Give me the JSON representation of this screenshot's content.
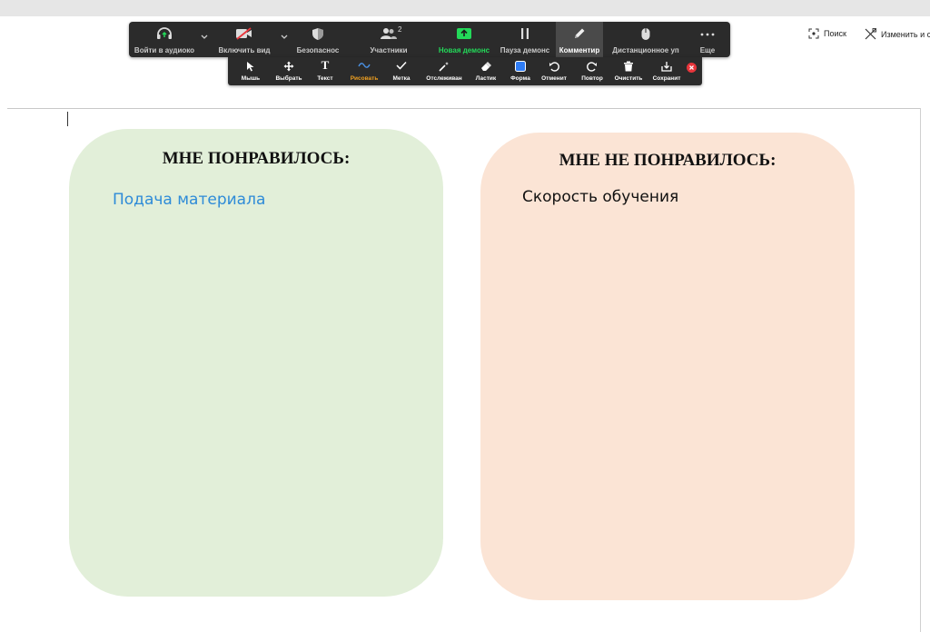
{
  "meeting_toolbar": {
    "audio": "Войти в аудиоко",
    "video": "Включить вид",
    "security": "Безопаснос",
    "participants": "Участники",
    "participants_count": "2",
    "new_share": "Новая демонс",
    "pause_share": "Пауза демонс",
    "annotate": "Комментир",
    "remote_control": "Дистанционное уп",
    "more": "Еще"
  },
  "annotation_toolbar": {
    "mouse": "Мышь",
    "select": "Выбрать",
    "text": "Текст",
    "draw": "Рисовать",
    "stamp": "Метка",
    "spotlight": "Отслеживан",
    "eraser": "Ластик",
    "format": "Форма",
    "undo": "Отменит",
    "redo": "Повтор",
    "clear": "Очистить",
    "save": "Сохранит"
  },
  "right_links": {
    "search": "Поиск",
    "edit": "Изменить и с"
  },
  "cards": {
    "liked": {
      "title": "МНЕ ПОНРАВИЛОСЬ:",
      "text": "Подача материала"
    },
    "disliked": {
      "title": "МНЕ НЕ ПОНРАВИЛОСЬ:",
      "text": "Скорость обучения"
    }
  },
  "colors": {
    "liked_bg": "#e2efd9",
    "disliked_bg": "#fbe4d5",
    "liked_text": "#2e8bd8",
    "toolbar_bg": "#2b2b2b",
    "share_green": "#23d959",
    "draw_orange": "#f0a020",
    "close_red": "#e8353b"
  }
}
